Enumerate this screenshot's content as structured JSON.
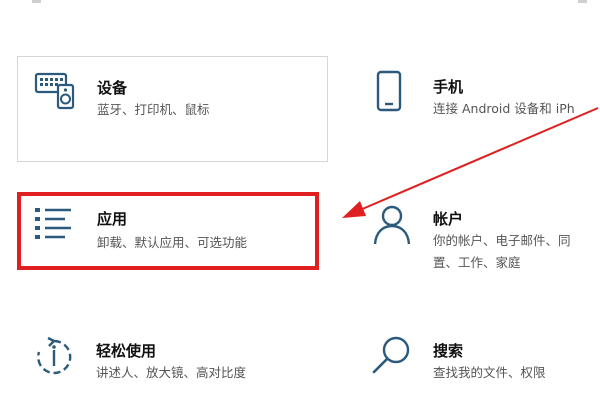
{
  "tiles": {
    "devices": {
      "title": "设备",
      "desc": "蓝牙、打印机、鼠标",
      "icon": "keyboard-speaker-icon"
    },
    "phone": {
      "title": "手机",
      "desc": "连接 Android 设备和 iPh",
      "icon": "phone-icon"
    },
    "apps": {
      "title": "应用",
      "desc": "卸载、默认应用、可选功能",
      "icon": "apps-list-icon"
    },
    "accounts": {
      "title": "帐户",
      "desc_line1": "你的帐户、电子邮件、同",
      "desc_line2": "置、工作、家庭",
      "icon": "person-icon"
    },
    "ease": {
      "title": "轻松使用",
      "desc": "讲述人、放大镜、高对比度",
      "icon": "ease-of-access-icon"
    },
    "search": {
      "title": "搜索",
      "desc": "查找我的文件、权限",
      "icon": "search-icon"
    }
  },
  "annotation": {
    "arrow_color": "#e02020",
    "highlight_color": "#e02020"
  }
}
